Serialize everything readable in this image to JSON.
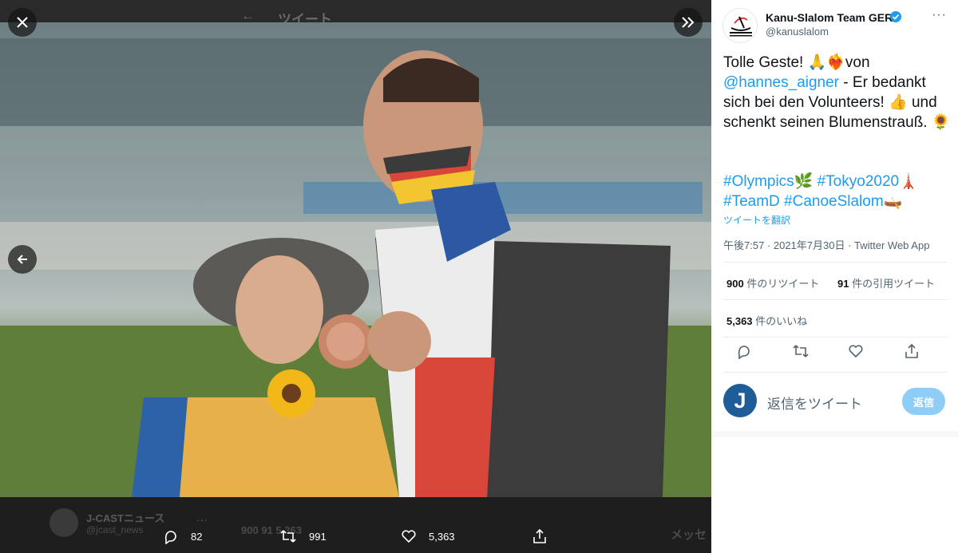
{
  "background_page": {
    "header_title": "ツイート",
    "author_name": "J-CASTニュース",
    "author_handle": "@jcast_news",
    "stat_retweets": "900",
    "stat_quotes": "91",
    "stat_likes": "5,363",
    "right_partial": "メッセ"
  },
  "media_viewer": {
    "close_icon": "close-icon",
    "collapse_icon": "double-chevron-right-icon",
    "prev_icon": "arrow-left-icon",
    "actions": {
      "reply_count": "82",
      "retweet_count": "991",
      "like_count": "5,363"
    }
  },
  "tweet": {
    "author_name": "Kanu-Slalom Team GER",
    "author_handle": "@kanuslalom",
    "avatar_text": "Kanu-Slalom Team Deutschland",
    "text_1": "Tolle Geste! 🙏❤️‍🔥von",
    "mention": "@hannes_aigner",
    "text_2": " - Er bedankt sich bei den Volunteers! 👍 und schenkt seinen Blumenstrauß. 🌻",
    "hashtags_line1": "#Olympics🌿 #Tokyo2020🗼",
    "hashtags_line2": "#TeamD #CanoeSlalom🛶",
    "translate_label": "ツイートを翻訳",
    "meta": "午後7:57 · 2021年7月30日 · Twitter Web App",
    "retweets_count": "900",
    "retweets_label": " 件のリツイート",
    "quotes_count": "91",
    "quotes_label": " 件の引用ツイート",
    "likes_count": "5,363",
    "likes_label": " 件のいいね",
    "reply_placeholder": "返信をツイート",
    "reply_button": "返信",
    "reply_avatar_letter": "J"
  },
  "colors": {
    "accent": "#1d9bf0",
    "reply_button": "#8ecdf7",
    "reply_avatar": "#1f5d99"
  }
}
